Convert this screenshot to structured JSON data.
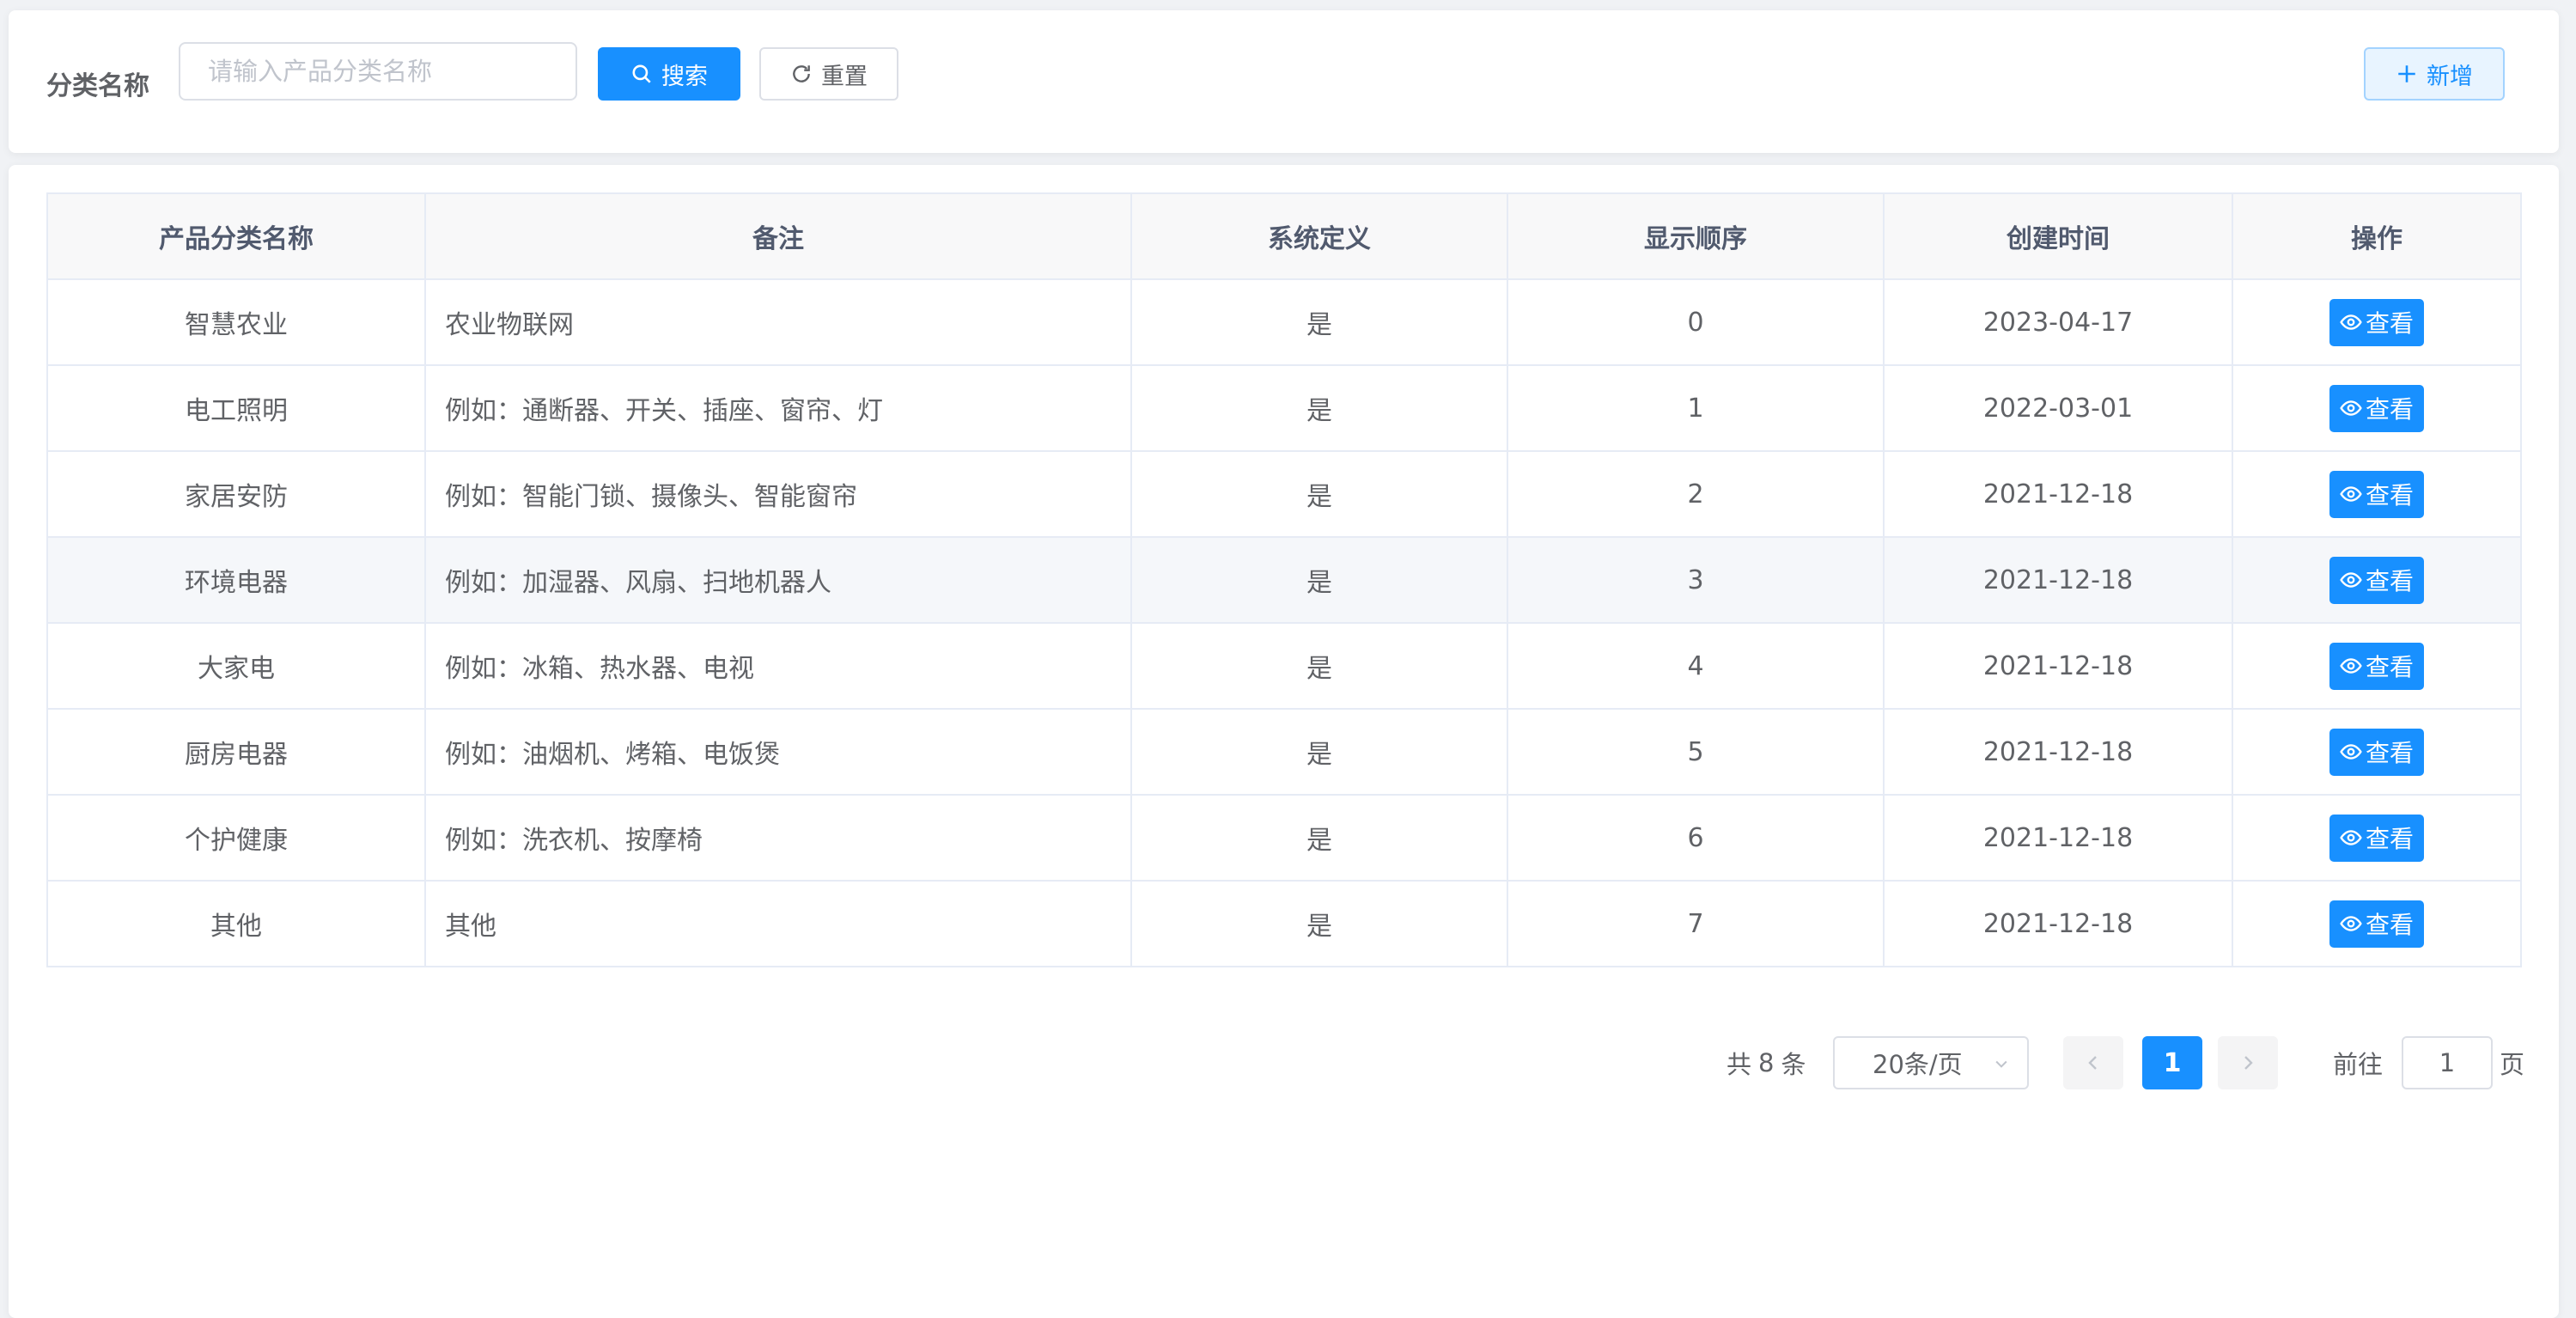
{
  "filter": {
    "label": "分类名称",
    "placeholder": "请输入产品分类名称",
    "search_label": "搜索",
    "reset_label": "重置",
    "add_label": "新增"
  },
  "table": {
    "headers": [
      "产品分类名称",
      "备注",
      "系统定义",
      "显示顺序",
      "创建时间",
      "操作"
    ],
    "rows": [
      {
        "name": "智慧农业",
        "remark": "农业物联网",
        "system": "是",
        "order": "0",
        "created": "2023-04-17",
        "action": "查看"
      },
      {
        "name": "电工照明",
        "remark": "例如：通断器、开关、插座、窗帘、灯",
        "system": "是",
        "order": "1",
        "created": "2022-03-01",
        "action": "查看"
      },
      {
        "name": "家居安防",
        "remark": "例如：智能门锁、摄像头、智能窗帘",
        "system": "是",
        "order": "2",
        "created": "2021-12-18",
        "action": "查看"
      },
      {
        "name": "环境电器",
        "remark": "例如：加湿器、风扇、扫地机器人",
        "system": "是",
        "order": "3",
        "created": "2021-12-18",
        "action": "查看"
      },
      {
        "name": "大家电",
        "remark": "例如：冰箱、热水器、电视",
        "system": "是",
        "order": "4",
        "created": "2021-12-18",
        "action": "查看"
      },
      {
        "name": "厨房电器",
        "remark": "例如：油烟机、烤箱、电饭煲",
        "system": "是",
        "order": "5",
        "created": "2021-12-18",
        "action": "查看"
      },
      {
        "name": "个护健康",
        "remark": "例如：洗衣机、按摩椅",
        "system": "是",
        "order": "6",
        "created": "2021-12-18",
        "action": "查看"
      },
      {
        "name": "其他",
        "remark": "其他",
        "system": "是",
        "order": "7",
        "created": "2021-12-18",
        "action": "查看"
      }
    ]
  },
  "pagination": {
    "total_prefix": "共",
    "total": "8",
    "total_suffix": "条",
    "page_size": "20条/页",
    "current_page": "1",
    "goto_label": "前往",
    "goto_value": "1",
    "page_suffix": "页"
  },
  "colors": {
    "primary": "#1890ff",
    "background": "#f0f2f5"
  },
  "icons": {
    "search": "search-icon",
    "reset": "refresh-icon",
    "add": "plus-icon",
    "view": "eye-icon",
    "prev": "chevron-left-icon",
    "next": "chevron-right-icon",
    "dropdown": "chevron-down-icon"
  }
}
